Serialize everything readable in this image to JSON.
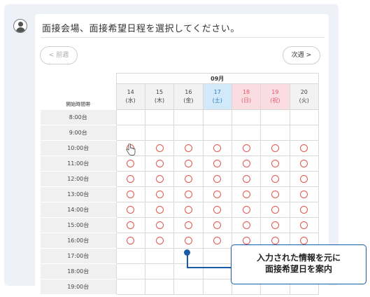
{
  "header": {
    "title": "面接会場、面接希望日程を選択してください。"
  },
  "nav": {
    "prev_label": "< 前週",
    "next_label": "次週 >"
  },
  "table": {
    "month": "09月",
    "time_header": "開始時間帯",
    "days": [
      {
        "date": "14",
        "dow": "(水)",
        "kind": "wd"
      },
      {
        "date": "15",
        "dow": "(木)",
        "kind": "wd"
      },
      {
        "date": "16",
        "dow": "(金)",
        "kind": "wd"
      },
      {
        "date": "17",
        "dow": "(土)",
        "kind": "sat"
      },
      {
        "date": "18",
        "dow": "(日)",
        "kind": "sun"
      },
      {
        "date": "19",
        "dow": "(祝)",
        "kind": "hol"
      },
      {
        "date": "20",
        "dow": "(火)",
        "kind": "wd"
      }
    ],
    "times": [
      "8:00台",
      "9:00台",
      "10:00台",
      "11:00台",
      "12:00台",
      "13:00台",
      "14:00台",
      "15:00台",
      "16:00台",
      "17:00台",
      "18:00台",
      "19:00台"
    ],
    "available_symbol": "○",
    "availability": [
      [
        false,
        false,
        false,
        false,
        false,
        false,
        false
      ],
      [
        false,
        false,
        false,
        false,
        false,
        false,
        false
      ],
      [
        true,
        true,
        true,
        true,
        true,
        true,
        true
      ],
      [
        true,
        true,
        true,
        true,
        true,
        true,
        true
      ],
      [
        true,
        true,
        true,
        true,
        true,
        true,
        true
      ],
      [
        true,
        true,
        true,
        true,
        true,
        true,
        true
      ],
      [
        true,
        true,
        true,
        true,
        true,
        true,
        true
      ],
      [
        true,
        true,
        true,
        true,
        true,
        true,
        true
      ],
      [
        true,
        true,
        true,
        true,
        true,
        true,
        true
      ],
      [
        false,
        false,
        false,
        false,
        false,
        false,
        false
      ],
      [
        false,
        false,
        false,
        false,
        false,
        false,
        false
      ],
      [
        false,
        false,
        false,
        false,
        false,
        false,
        false
      ]
    ]
  },
  "callout": {
    "line1": "入力された情報を元に",
    "line2": "面接希望日を案内"
  },
  "colors": {
    "accent_blue": "#1a5ba8",
    "circle_red": "#e2574c",
    "saturday_bg": "#d1e9f8",
    "sunday_bg": "#f9dde2"
  },
  "icons": {
    "avatar": "user-avatar-icon",
    "cursor": "hand-pointer-icon"
  }
}
